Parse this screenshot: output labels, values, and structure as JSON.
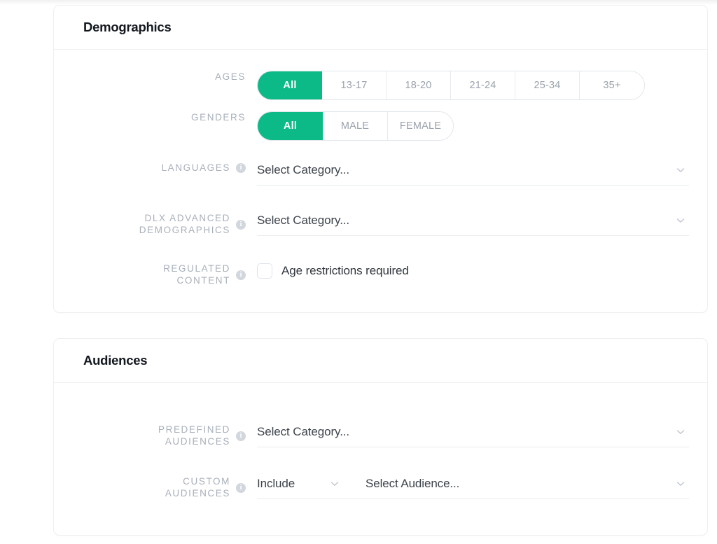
{
  "demographics": {
    "title": "Demographics",
    "ages": {
      "label": "AGES",
      "options": [
        "All",
        "13-17",
        "18-20",
        "21-24",
        "25-34",
        "35+"
      ],
      "selected": "All"
    },
    "genders": {
      "label": "GENDERS",
      "options": [
        "All",
        "MALE",
        "FEMALE"
      ],
      "selected": "All"
    },
    "languages": {
      "label": "LANGUAGES",
      "value": "Select Category...",
      "info_icon": "info-icon",
      "chevron_icon": "chevron-down-icon"
    },
    "dlx_advanced_demographics": {
      "label": "DLX ADVANCED\nDEMOGRAPHICS",
      "value": "Select Category...",
      "info_icon": "info-icon",
      "chevron_icon": "chevron-down-icon"
    },
    "regulated_content": {
      "label": "REGULATED\nCONTENT",
      "checkbox_label": "Age restrictions required",
      "checked": false,
      "info_icon": "info-icon"
    }
  },
  "audiences": {
    "title": "Audiences",
    "predefined": {
      "label": "PREDEFINED\nAUDIENCES",
      "value": "Select Category...",
      "info_icon": "info-icon",
      "chevron_icon": "chevron-down-icon"
    },
    "custom": {
      "label": "CUSTOM\nAUDIENCES",
      "mode_value": "Include",
      "audience_value": "Select Audience...",
      "info_icon": "info-icon",
      "chevron_icon": "chevron-down-icon"
    }
  },
  "colors": {
    "accent_green": "#0bba86",
    "label_gray": "#a9b0ba",
    "text_dark": "#2f353c",
    "border": "#e9ebee",
    "card_border": "#edeff1"
  },
  "icons": {
    "info": "i",
    "chevron_down": "chevron-down-icon"
  }
}
